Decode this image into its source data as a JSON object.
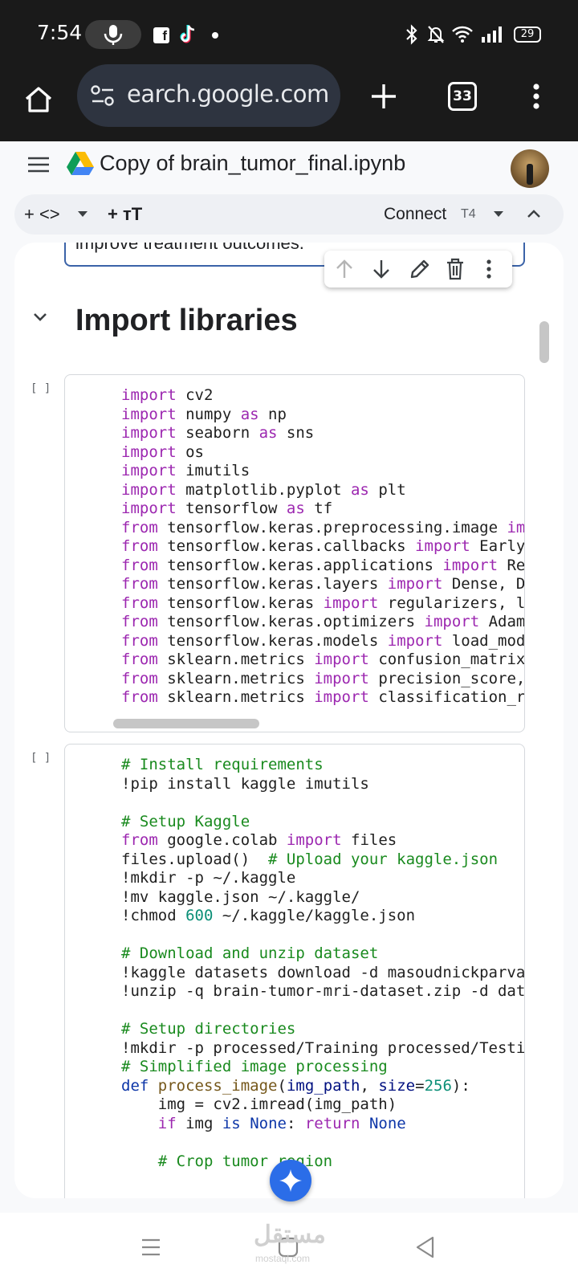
{
  "status_bar": {
    "time": "7:54",
    "battery": "29"
  },
  "browser": {
    "url": "earch.google.com",
    "tab_count": "33"
  },
  "notebook": {
    "title": "Copy of brain_tumor_final.ipynb",
    "toolbar": {
      "add_code": "+ <>",
      "add_text": "+ тT",
      "connect": "Connect",
      "runtime": "T4"
    },
    "previous_cell_text": "improve treatment outcomes.",
    "section_heading": "Import libraries",
    "run_button": "[ ]"
  },
  "cells": [
    {
      "lines": [
        [
          [
            "kw",
            "import"
          ],
          [
            "p",
            " cv2"
          ]
        ],
        [
          [
            "kw",
            "import"
          ],
          [
            "p",
            " numpy "
          ],
          [
            "kw",
            "as"
          ],
          [
            "p",
            " np"
          ]
        ],
        [
          [
            "kw",
            "import"
          ],
          [
            "p",
            " seaborn "
          ],
          [
            "kw",
            "as"
          ],
          [
            "p",
            " sns"
          ]
        ],
        [
          [
            "kw",
            "import"
          ],
          [
            "p",
            " os"
          ]
        ],
        [
          [
            "kw",
            "import"
          ],
          [
            "p",
            " imutils"
          ]
        ],
        [
          [
            "kw",
            "import"
          ],
          [
            "p",
            " matplotlib.pyplot "
          ],
          [
            "kw",
            "as"
          ],
          [
            "p",
            " plt"
          ]
        ],
        [
          [
            "kw",
            "import"
          ],
          [
            "p",
            " tensorflow "
          ],
          [
            "kw",
            "as"
          ],
          [
            "p",
            " tf"
          ]
        ],
        [
          [
            "kw",
            "from"
          ],
          [
            "p",
            " tensorflow.keras.preprocessing.image "
          ],
          [
            "kw",
            "imp"
          ]
        ],
        [
          [
            "kw",
            "from"
          ],
          [
            "p",
            " tensorflow.keras.callbacks "
          ],
          [
            "kw",
            "import"
          ],
          [
            "p",
            " EarlyS"
          ]
        ],
        [
          [
            "kw",
            "from"
          ],
          [
            "p",
            " tensorflow.keras.applications "
          ],
          [
            "kw",
            "import"
          ],
          [
            "p",
            " Res"
          ]
        ],
        [
          [
            "kw",
            "from"
          ],
          [
            "p",
            " tensorflow.keras.layers "
          ],
          [
            "kw",
            "import"
          ],
          [
            "p",
            " Dense, Dr"
          ]
        ],
        [
          [
            "kw",
            "from"
          ],
          [
            "p",
            " tensorflow.keras "
          ],
          [
            "kw",
            "import"
          ],
          [
            "p",
            " regularizers, la"
          ]
        ],
        [
          [
            "kw",
            "from"
          ],
          [
            "p",
            " tensorflow.keras.optimizers "
          ],
          [
            "kw",
            "import"
          ],
          [
            "p",
            " Adam"
          ]
        ],
        [
          [
            "kw",
            "from"
          ],
          [
            "p",
            " tensorflow.keras.models "
          ],
          [
            "kw",
            "import"
          ],
          [
            "p",
            " load_mode"
          ]
        ],
        [
          [
            "kw",
            "from"
          ],
          [
            "p",
            " sklearn.metrics "
          ],
          [
            "kw",
            "import"
          ],
          [
            "p",
            " confusion_matrix"
          ]
        ],
        [
          [
            "kw",
            "from"
          ],
          [
            "p",
            " sklearn.metrics "
          ],
          [
            "kw",
            "import"
          ],
          [
            "p",
            " precision_score,"
          ]
        ],
        [
          [
            "kw",
            "from"
          ],
          [
            "p",
            " sklearn.metrics "
          ],
          [
            "kw",
            "import"
          ],
          [
            "p",
            " classification_r"
          ]
        ]
      ]
    },
    {
      "lines": [
        [
          [
            "com",
            "# Install requirements"
          ]
        ],
        [
          [
            "p",
            "!pip install kaggle imutils"
          ]
        ],
        [],
        [
          [
            "com",
            "# Setup Kaggle"
          ]
        ],
        [
          [
            "kw",
            "from"
          ],
          [
            "p",
            " google.colab "
          ],
          [
            "kw",
            "import"
          ],
          [
            "p",
            " files"
          ]
        ],
        [
          [
            "p",
            "files.upload()  "
          ],
          [
            "com",
            "# Upload your kaggle.json"
          ]
        ],
        [
          [
            "p",
            "!mkdir -p ~/.kaggle"
          ]
        ],
        [
          [
            "p",
            "!mv kaggle.json ~/.kaggle/"
          ]
        ],
        [
          [
            "p",
            "!chmod "
          ],
          [
            "num",
            "600"
          ],
          [
            "p",
            " ~/.kaggle/kaggle.json"
          ]
        ],
        [],
        [
          [
            "com",
            "# Download and unzip dataset"
          ]
        ],
        [
          [
            "p",
            "!kaggle datasets download -d masoudnickparvar"
          ]
        ],
        [
          [
            "p",
            "!unzip -q brain-tumor-mri-dataset.zip -d data"
          ]
        ],
        [],
        [
          [
            "com",
            "# Setup directories"
          ]
        ],
        [
          [
            "p",
            "!mkdir -p processed/Training processed/Testin"
          ]
        ],
        [
          [
            "com",
            "# Simplified image processing"
          ]
        ],
        [
          [
            "kw2",
            "def"
          ],
          [
            "p",
            " "
          ],
          [
            "fn",
            "process_image"
          ],
          [
            "p",
            "("
          ],
          [
            "param",
            "img_path"
          ],
          [
            "p",
            ", "
          ],
          [
            "param",
            "size"
          ],
          [
            "p",
            "="
          ],
          [
            "num",
            "256"
          ],
          [
            "p",
            "):"
          ]
        ],
        [
          [
            "p",
            "    img = cv2.imread(img_path)"
          ]
        ],
        [
          [
            "p",
            "    "
          ],
          [
            "kw",
            "if"
          ],
          [
            "p",
            " img "
          ],
          [
            "kw2",
            "is"
          ],
          [
            "p",
            " "
          ],
          [
            "kw2",
            "None"
          ],
          [
            "p",
            ": "
          ],
          [
            "kw",
            "return"
          ],
          [
            "p",
            " "
          ],
          [
            "kw2",
            "None"
          ]
        ],
        [],
        [
          [
            "p",
            "    "
          ],
          [
            "com",
            "# Crop tumor region"
          ]
        ]
      ]
    }
  ],
  "watermark": {
    "text": "مستقل",
    "sub": "mostaql.com"
  }
}
